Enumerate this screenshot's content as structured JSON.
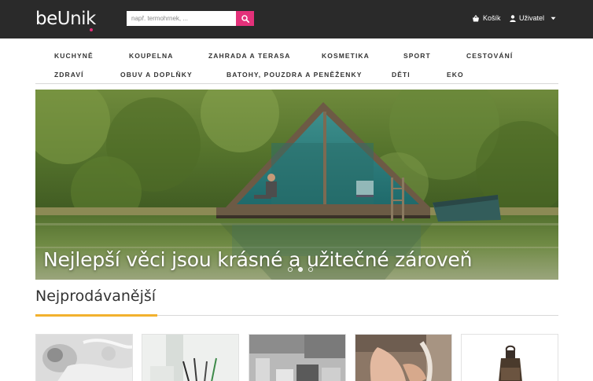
{
  "header": {
    "logo_be": "be",
    "logo_unik": "Unik",
    "search": {
      "placeholder": "např. termohrnek, ..."
    },
    "cart_label": "Košík",
    "user_label": "Uživatel"
  },
  "nav": {
    "items": [
      "KUCHYNĚ",
      "KOUPELNA",
      "ZAHRADA A TERASA",
      "KOSMETIKA",
      "SPORT",
      "CESTOVÁNÍ",
      "ZDRAVÍ",
      "OBUV A DOPLŇKY",
      "BATOHY, POUZDRA A PENĚŽENKY",
      "DĚTI",
      "EKO"
    ]
  },
  "hero": {
    "caption": "Nejlepší věci jsou krásné a užitečné zároveň",
    "slides": 3,
    "active_slide": 1
  },
  "section": {
    "title": "Nejprodávanější"
  },
  "icons": {
    "search": "search-icon",
    "cart": "basket-icon",
    "user": "user-icon",
    "caret": "caret-down-icon"
  },
  "colors": {
    "header_bg": "#2a2a2a",
    "accent_pink": "#e4317a",
    "accent_yellow": "#f2b12e"
  }
}
